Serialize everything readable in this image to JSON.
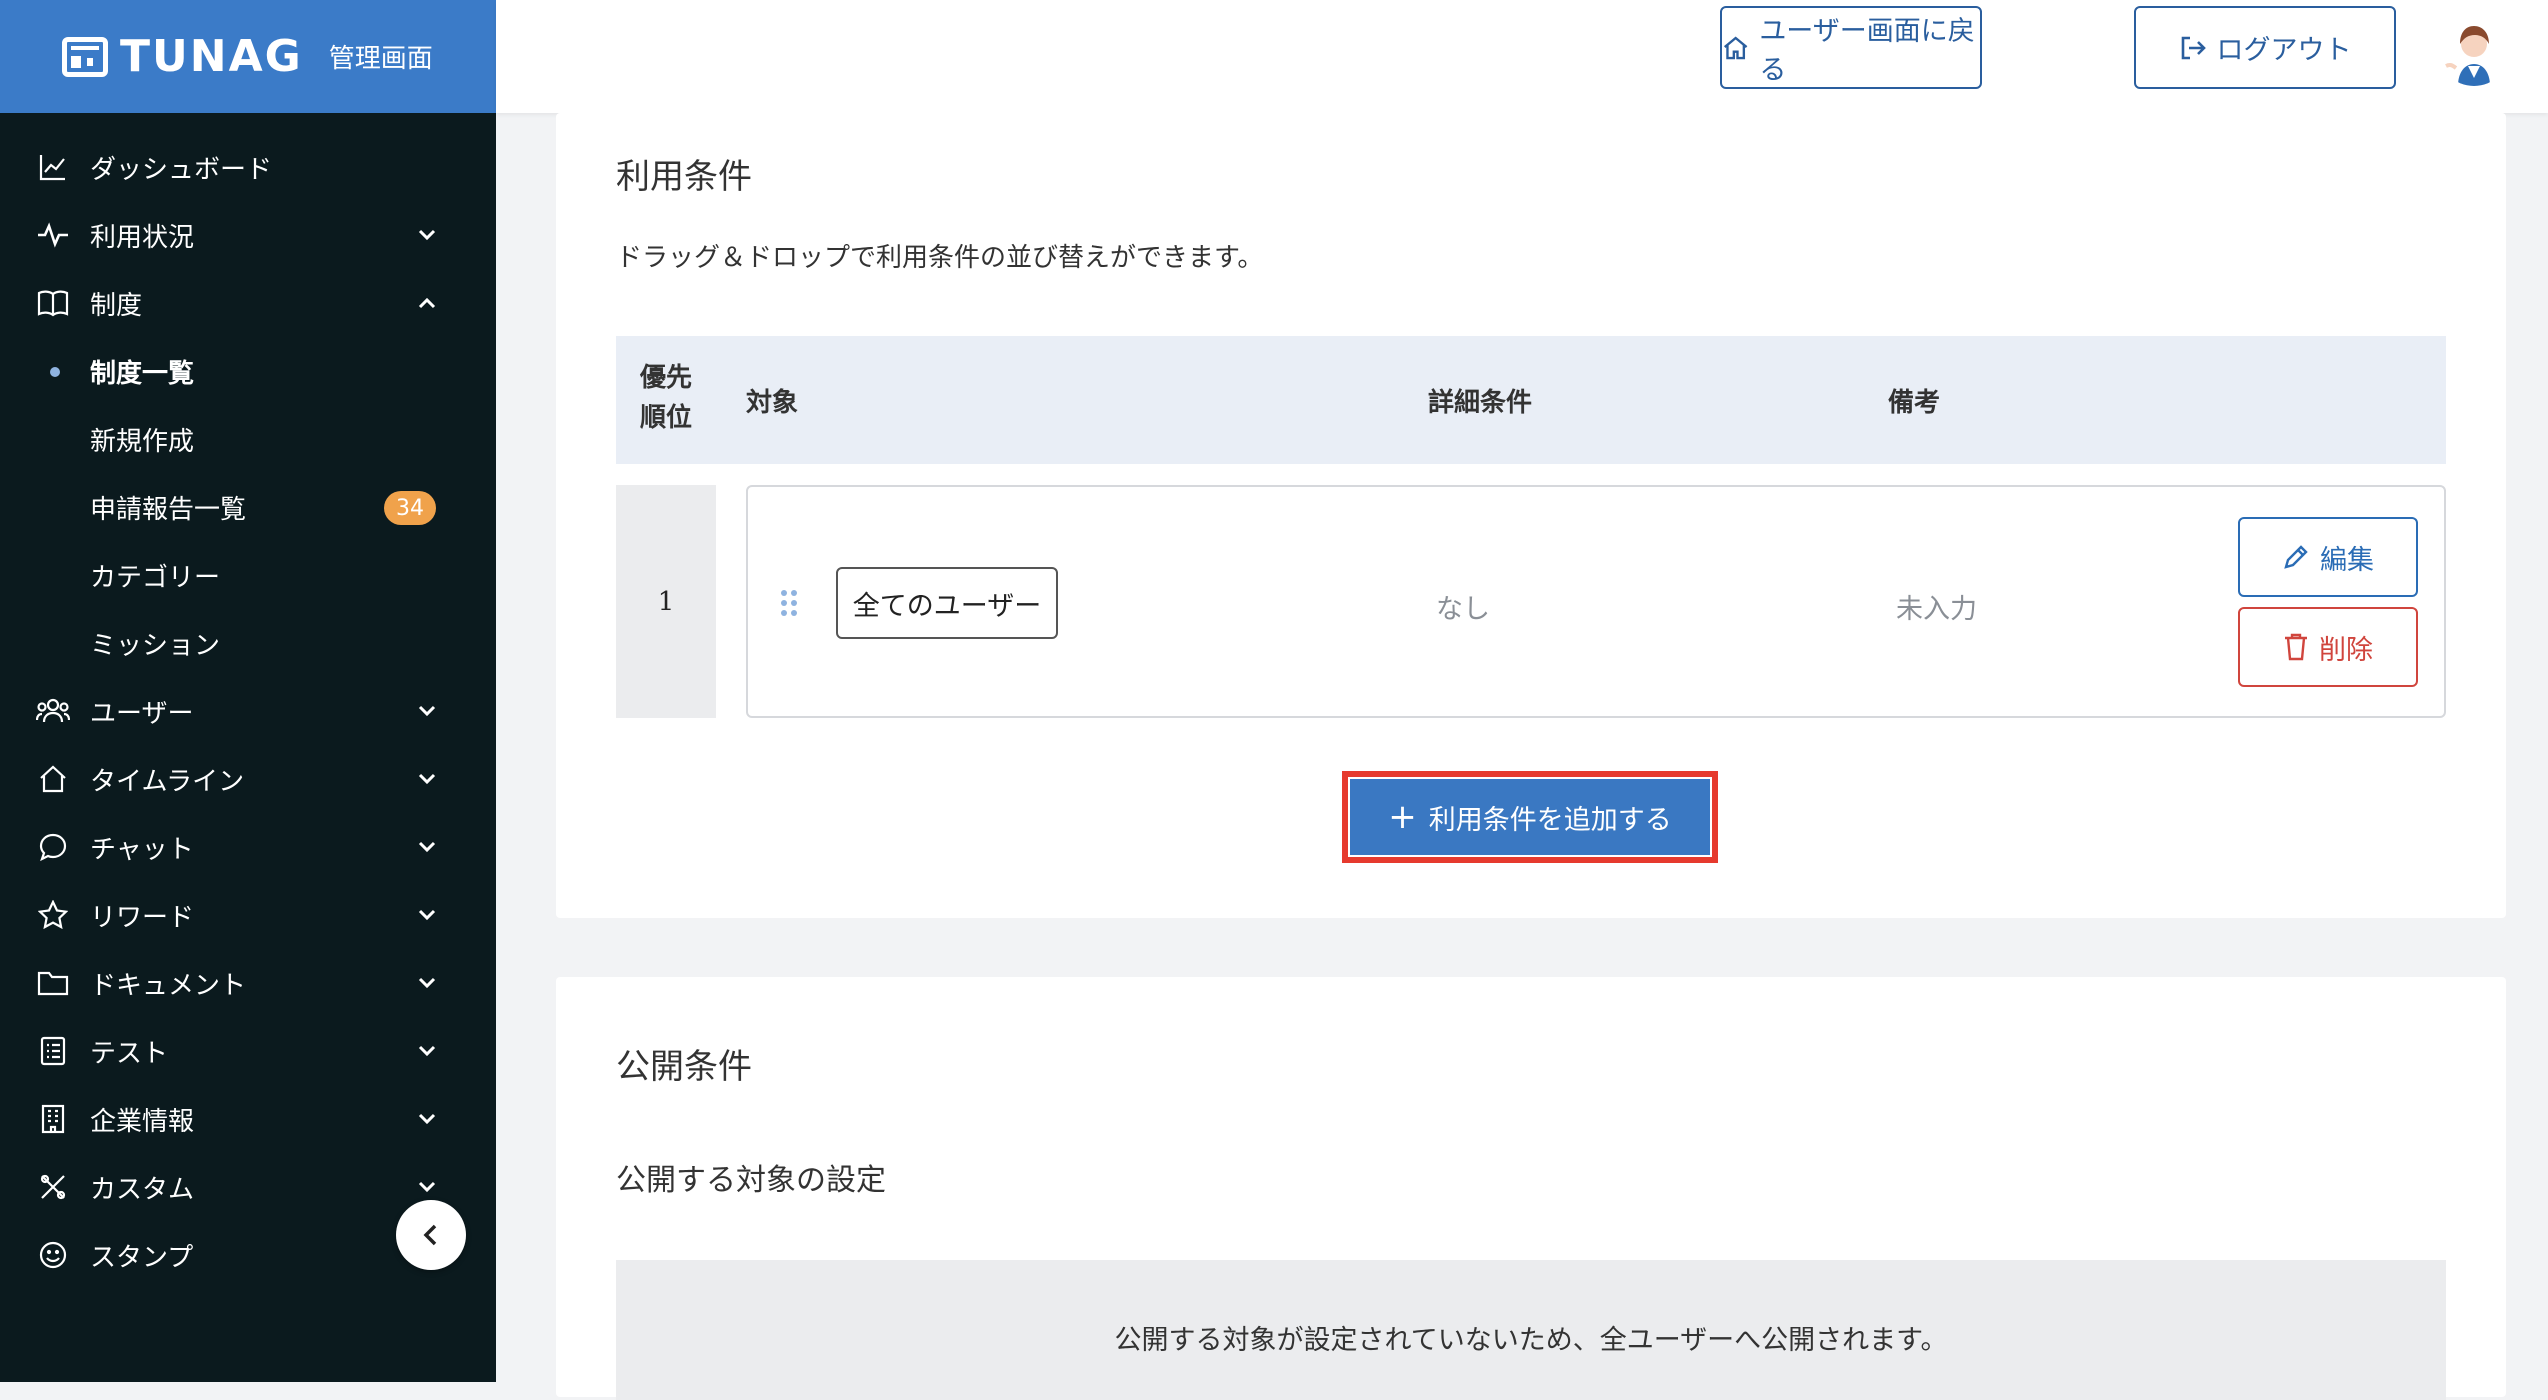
{
  "app": {
    "logo_text": "TUNAG",
    "logo_sub": "管理画面"
  },
  "header": {
    "user_screen_label": "ユーザー画面に戻る",
    "logout_label": "ログアウト"
  },
  "sidebar": {
    "items": [
      {
        "label": "ダッシュボード",
        "icon": "chart-icon"
      },
      {
        "label": "利用状況",
        "icon": "pulse-icon"
      },
      {
        "label": "制度",
        "icon": "book-icon"
      },
      {
        "label": "ユーザー",
        "icon": "users-icon"
      },
      {
        "label": "タイムライン",
        "icon": "home-icon"
      },
      {
        "label": "チャット",
        "icon": "chat-icon"
      },
      {
        "label": "リワード",
        "icon": "star-icon"
      },
      {
        "label": "ドキュメント",
        "icon": "folder-icon"
      },
      {
        "label": "テスト",
        "icon": "list-icon"
      },
      {
        "label": "企業情報",
        "icon": "building-icon"
      },
      {
        "label": "カスタム",
        "icon": "tools-icon"
      },
      {
        "label": "スタンプ",
        "icon": "smile-icon"
      }
    ],
    "sub_items": [
      {
        "label": "制度一覧"
      },
      {
        "label": "新規作成"
      },
      {
        "label": "申請報告一覧",
        "badge": "34"
      },
      {
        "label": "カテゴリー"
      },
      {
        "label": "ミッション"
      }
    ]
  },
  "usage": {
    "title": "利用条件",
    "description": "ドラッグ＆ドロップで利用条件の並び替えができます。",
    "columns": {
      "rank_line1": "優先",
      "rank_line2": "順位",
      "target": "対象",
      "detail": "詳細条件",
      "note": "備考"
    },
    "rows": [
      {
        "rank": "1",
        "target": "全てのユーザー",
        "detail": "なし",
        "note": "未入力"
      }
    ],
    "edit_label": "編集",
    "delete_label": "削除",
    "add_label": "利用条件を追加する",
    "add_plus": "+"
  },
  "publish": {
    "title": "公開条件",
    "subtitle": "公開する対象の設定",
    "empty_text": "公開する対象が設定されていないため、全ユーザーへ公開されます。"
  },
  "colors": {
    "sidebar_bg": "#0b1a1e",
    "brand_blue": "#3b7bc8",
    "badge": "#f0a24b",
    "danger": "#d0453d",
    "highlight": "#e63a2e"
  }
}
